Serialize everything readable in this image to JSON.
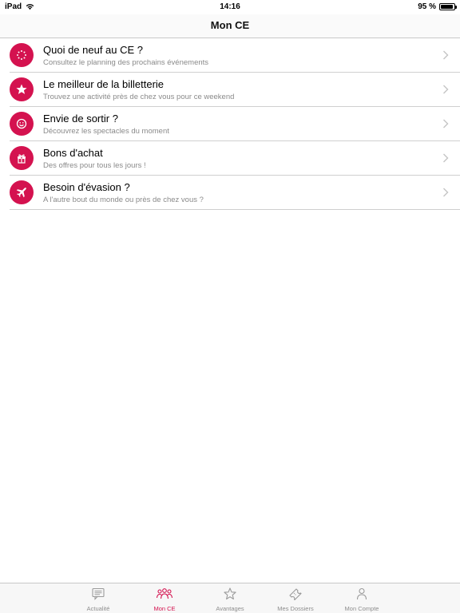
{
  "status_bar": {
    "device": "iPad",
    "time": "14:16",
    "battery": "95 %",
    "battery_level": 0.95
  },
  "nav": {
    "title": "Mon CE"
  },
  "accent_color": "#d4124f",
  "menu": [
    {
      "title": "Quoi de neuf au CE ?",
      "subtitle": "Consultez le planning des prochains événements",
      "icon": "dotted-circle-icon"
    },
    {
      "title": "Le meilleur de la billetterie",
      "subtitle": "Trouvez une activité près de chez vous pour ce weekend",
      "icon": "star-icon"
    },
    {
      "title": "Envie de sortir ?",
      "subtitle": "Découvrez les spectacles du moment",
      "icon": "smiley-icon"
    },
    {
      "title": "Bons d'achat",
      "subtitle": "Des offres pour tous les jours !",
      "icon": "gift-icon"
    },
    {
      "title": "Besoin d'évasion ?",
      "subtitle": "A l'autre bout du monde ou près de chez vous ?",
      "icon": "airplane-icon"
    }
  ],
  "tabs": [
    {
      "label": "Actualité",
      "icon": "news-icon",
      "active": false
    },
    {
      "label": "Mon CE",
      "icon": "group-icon",
      "active": true
    },
    {
      "label": "Avantages",
      "icon": "star-outline-icon",
      "active": false
    },
    {
      "label": "Mes Dossiers",
      "icon": "ticket-icon",
      "active": false
    },
    {
      "label": "Mon Compte",
      "icon": "person-icon",
      "active": false
    }
  ]
}
